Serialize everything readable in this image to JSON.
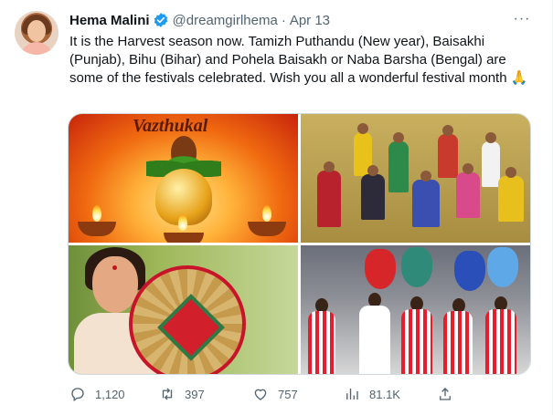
{
  "tweet": {
    "author_name": "Hema Malini",
    "handle": "@dreamgirlhema",
    "separator": "·",
    "date": "Apr 13",
    "more_label": "···",
    "text": "It is the Harvest season now. Tamizh Puthandu (New year), Baisakhi (Punjab), Bihu (Bihar) and Pohela Baisakh or Naba Barsha (Bengal) are some of the festivals celebrated. Wish you all a wonderful festival month 🙏",
    "image1_caption": "Vazthukal"
  },
  "actions": {
    "replies": "1,120",
    "retweets": "397",
    "likes": "757",
    "views": "81.1K"
  },
  "colors": {
    "verified_blue": "#1d9bf0",
    "secondary_text": "#536471",
    "primary_text": "#0f1419",
    "border": "#cfd9de"
  }
}
